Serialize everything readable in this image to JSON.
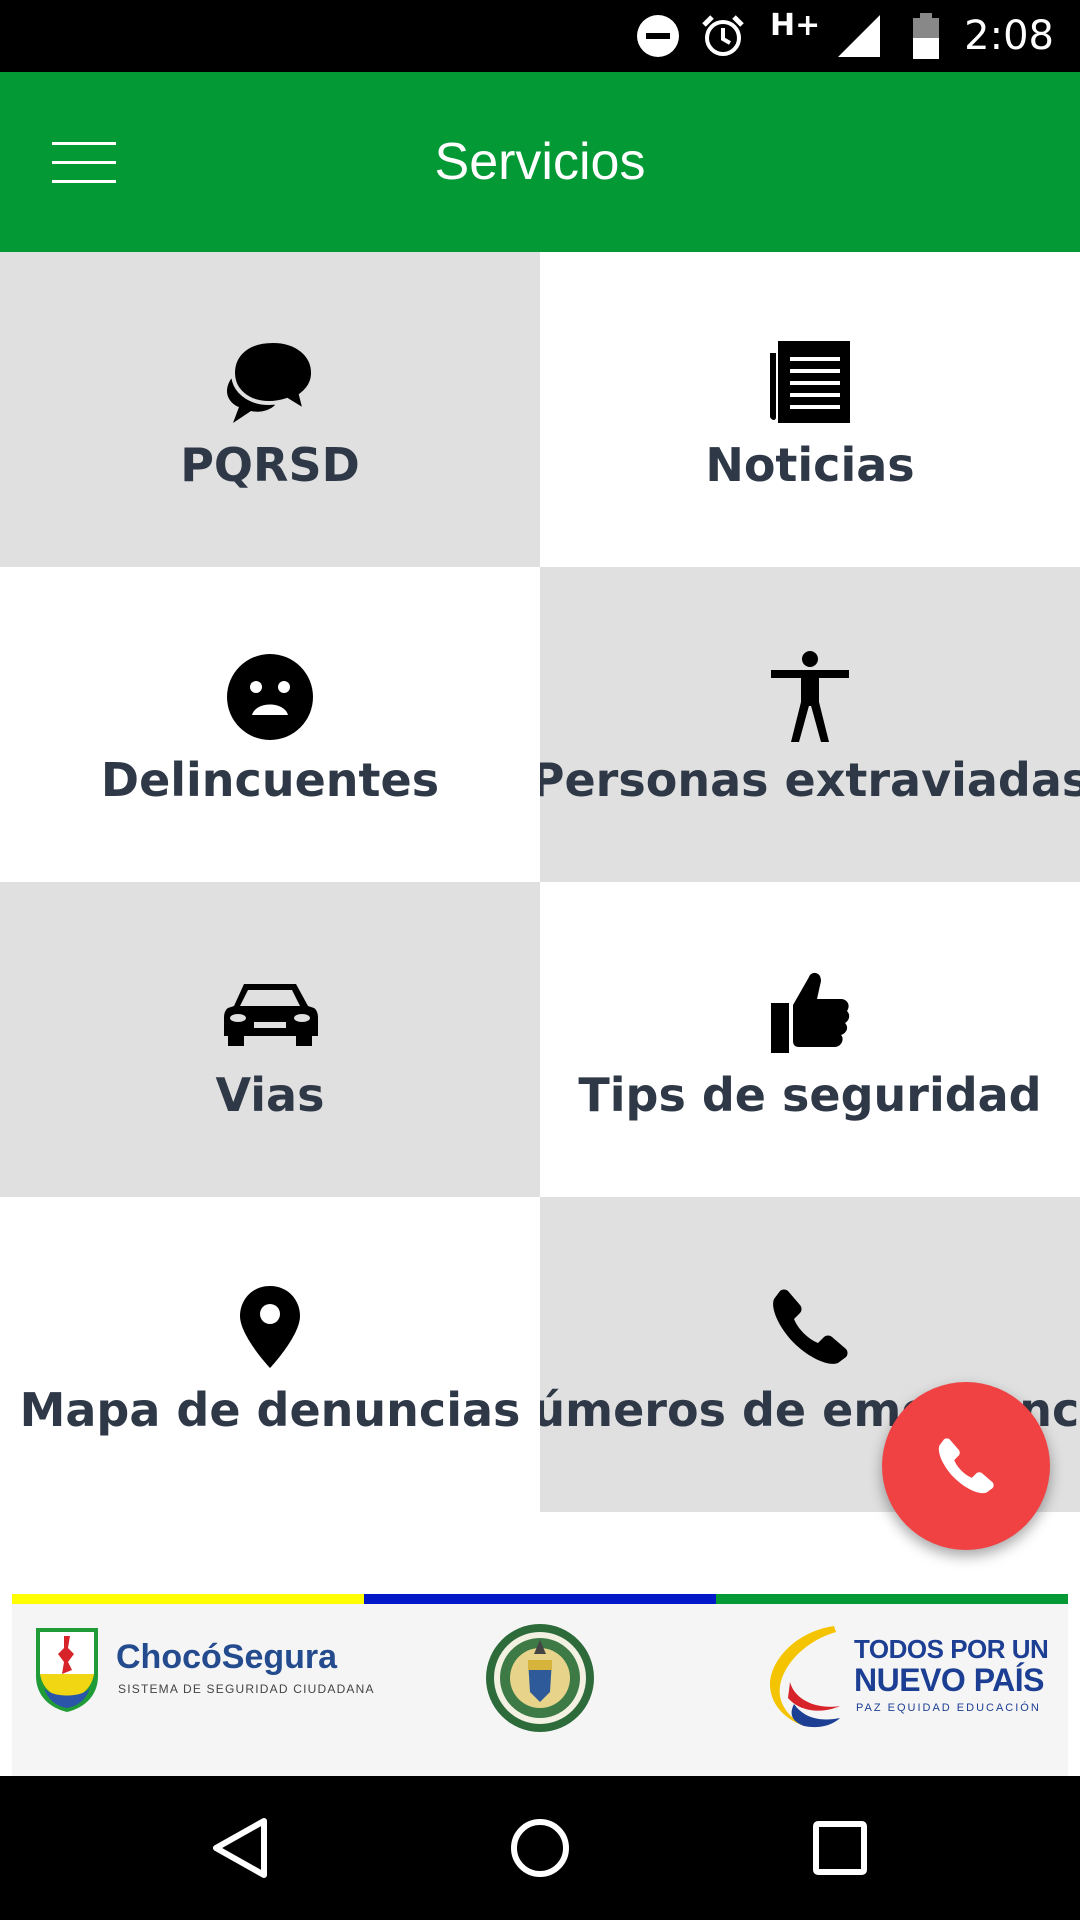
{
  "status_bar": {
    "time": "2:08",
    "network": "H+",
    "icons": [
      "do-not-disturb-icon",
      "alarm-icon",
      "signal-icon",
      "battery-icon"
    ]
  },
  "app_bar": {
    "title": "Servicios",
    "menu_icon": "hamburger-menu-icon"
  },
  "tiles": [
    {
      "label": "PQRSD",
      "icon": "chat-bubbles-icon"
    },
    {
      "label": "Noticias",
      "icon": "newspaper-icon"
    },
    {
      "label": "Delincuentes",
      "icon": "sad-face-icon"
    },
    {
      "label": "Personas extraviadas",
      "icon": "person-icon"
    },
    {
      "label": "Vias",
      "icon": "car-icon"
    },
    {
      "label": "Tips de seguridad",
      "icon": "thumbs-up-icon"
    },
    {
      "label": "Mapa de denuncias",
      "icon": "map-pin-icon"
    },
    {
      "label": "Números de emergencia",
      "icon": "phone-icon"
    }
  ],
  "fab": {
    "icon": "phone-icon",
    "color": "#f04143"
  },
  "footer": {
    "stripe_colors": [
      "#ffff00",
      "#0018c8",
      "#039935"
    ],
    "choco_name_part1": "Chocó",
    "choco_name_part2": "Segura",
    "choco_subtitle": "SISTEMA DE SEGURIDAD CIUDADANA",
    "nuevo_line1": "TODOS POR UN",
    "nuevo_line2": "NUEVO PAÍS",
    "nuevo_line3": "PAZ  EQUIDAD  EDUCACIÓN"
  },
  "colors": {
    "app_bar": "#039935",
    "tile_gray": "#e0e0e0",
    "tile_text": "#2f3847"
  }
}
